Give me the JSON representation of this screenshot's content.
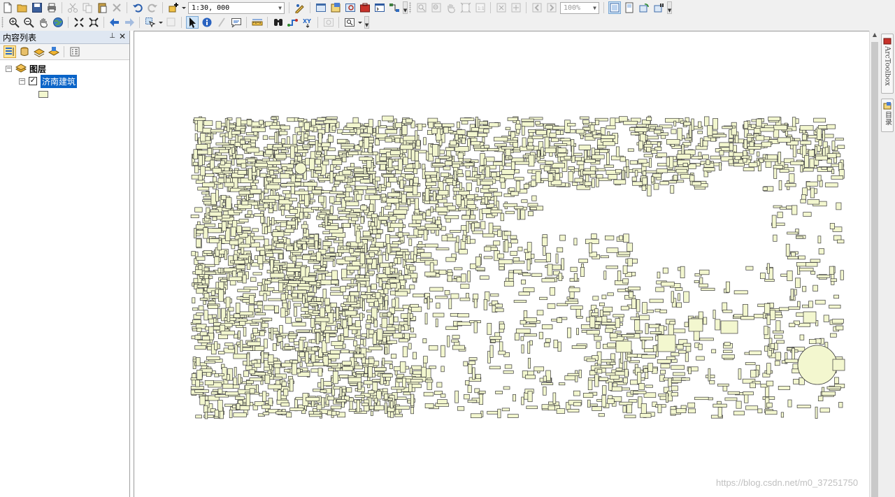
{
  "toolbar": {
    "scale_value": "1:30, 000",
    "zoom_value": "100%",
    "row1_icons": [
      "new-document-icon",
      "open-folder-icon",
      "save-icon",
      "print-icon",
      "cut-icon",
      "copy-icon",
      "paste-icon",
      "delete-icon",
      "undo-icon",
      "redo-icon",
      "add-data-icon",
      "editor-icon",
      "catalog-icon",
      "search-window-icon",
      "arctoolbox-icon",
      "python-icon",
      "modelbuilder-icon"
    ],
    "layout_icons": [
      "layout-zoom-in-icon",
      "layout-zoom-out-icon",
      "layout-pan-icon",
      "zoom-whole-page-icon",
      "zoom-100-icon",
      "fixed-zoom-in-icon",
      "fixed-zoom-out-icon",
      "back-extent-icon",
      "forward-extent-icon"
    ],
    "view_icons": [
      "data-view-icon",
      "layout-view-icon",
      "refresh-icon",
      "pause-draw-icon"
    ],
    "row2_icons": [
      "zoom-in-icon",
      "zoom-out-icon",
      "pan-icon",
      "full-extent-icon",
      "fixed-zoom-in-icon",
      "fixed-zoom-out-icon",
      "back-icon",
      "forward-icon",
      "select-features-icon",
      "clear-selection-icon",
      "select-elements-icon",
      "identify-icon",
      "hyperlink-icon",
      "html-popup-icon",
      "measure-icon",
      "find-icon",
      "find-route-icon",
      "xy-goto-icon",
      "time-slider-icon",
      "viewer-icon"
    ]
  },
  "toc": {
    "title": "内容列表",
    "tool_icons": [
      "list-by-drawing-order-icon",
      "list-by-source-icon",
      "list-by-visibility-icon",
      "list-by-selection-icon",
      "options-icon"
    ],
    "group_label": "图层",
    "layer_label": "济南建筑",
    "layer_checked": "✓",
    "legend_fill": "#f3f7cf"
  },
  "map": {
    "background": "#ffffff",
    "feature_fill": "#f3f7cf",
    "feature_stroke": "#3a3a3a"
  },
  "dock": {
    "arctoolbox_label": "ArcToolbox",
    "catalog_label": "目录"
  },
  "watermark": "https://blog.csdn.net/m0_37251750"
}
